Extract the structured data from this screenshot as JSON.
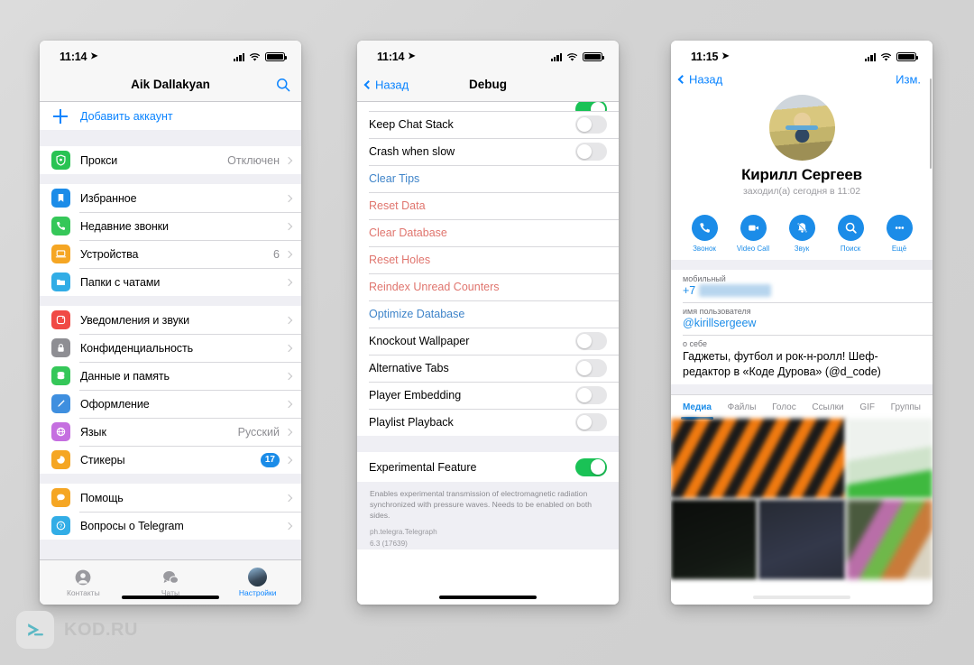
{
  "watermark": {
    "text": "KOD.RU",
    "logo_icon": "send-arrow-icon",
    "logo_color": "#5bb8c4"
  },
  "colors": {
    "ios_blue": "#0b84ff",
    "telegram_blue": "#1b8ce8",
    "destructive_red": "#e0756e",
    "toggle_on_green": "#1ac256",
    "group_bg": "#efeff4"
  },
  "phone1": {
    "status": {
      "time": "11:14",
      "location_icon": "location-arrow-icon",
      "signal_icon": "cellular-signal-icon",
      "wifi_icon": "wifi-icon",
      "battery_icon": "battery-full-icon"
    },
    "nav": {
      "title": "Aik Dallakyan",
      "search_icon": "search-icon"
    },
    "add_account": {
      "label": "Добавить аккаунт",
      "icon": "plus-icon"
    },
    "groups": [
      {
        "rows": [
          {
            "icon": "shield-proxy-icon",
            "color": "#29c353",
            "label": "Прокси",
            "value": "Отключен",
            "chevron": true
          }
        ]
      },
      {
        "rows": [
          {
            "icon": "bookmark-icon",
            "color": "#1b8ce8",
            "label": "Избранное",
            "value": "",
            "chevron": true
          },
          {
            "icon": "phone-icon",
            "color": "#35c759",
            "label": "Недавние звонки",
            "value": "",
            "chevron": true
          },
          {
            "icon": "laptop-icon",
            "color": "#f5a623",
            "label": "Устройства",
            "value": "6",
            "chevron": true
          },
          {
            "icon": "folder-icon",
            "color": "#32ade6",
            "label": "Папки с чатами",
            "value": "",
            "chevron": true
          }
        ]
      },
      {
        "rows": [
          {
            "icon": "bell-icon",
            "color": "#f04a45",
            "label": "Уведомления и звуки",
            "value": "",
            "chevron": true
          },
          {
            "icon": "lock-icon",
            "color": "#8e8e93",
            "label": "Конфиденциальность",
            "value": "",
            "chevron": true
          },
          {
            "icon": "database-icon",
            "color": "#35c759",
            "label": "Данные и память",
            "value": "",
            "chevron": true
          },
          {
            "icon": "brush-icon",
            "color": "#3f8fdf",
            "label": "Оформление",
            "value": "",
            "chevron": true
          },
          {
            "icon": "globe-icon",
            "color": "#c56fe0",
            "label": "Язык",
            "value": "Русский",
            "chevron": true
          },
          {
            "icon": "sticker-icon",
            "color": "#f5a623",
            "label": "Стикеры",
            "badge": "17",
            "chevron": true
          }
        ]
      },
      {
        "rows": [
          {
            "icon": "chat-help-icon",
            "color": "#f5a623",
            "label": "Помощь",
            "value": "",
            "chevron": true
          },
          {
            "icon": "question-icon",
            "color": "#32ade6",
            "label": "Вопросы о Telegram",
            "value": "",
            "chevron": true
          }
        ]
      }
    ],
    "tabbar": [
      {
        "icon": "contacts-person-icon",
        "label": "Контакты",
        "active": false
      },
      {
        "icon": "chats-bubbles-icon",
        "label": "Чаты",
        "active": false
      },
      {
        "icon": "settings-avatar-icon",
        "label": "Настройки",
        "active": true
      }
    ]
  },
  "phone2": {
    "status": {
      "time": "11:14",
      "location_icon": "location-arrow-icon",
      "signal_icon": "cellular-signal-icon",
      "wifi_icon": "wifi-icon",
      "battery_icon": "battery-full-icon"
    },
    "nav": {
      "back_label": "Назад",
      "title": "Debug",
      "back_icon": "chevron-left-icon"
    },
    "rows": [
      {
        "type": "toggle",
        "label": "",
        "on": true,
        "partial": true
      },
      {
        "type": "toggle",
        "label": "Keep Chat Stack",
        "on": false
      },
      {
        "type": "toggle",
        "label": "Crash when slow",
        "on": false
      },
      {
        "type": "action",
        "label": "Clear Tips",
        "style": "blue"
      },
      {
        "type": "action",
        "label": "Reset Data",
        "style": "red"
      },
      {
        "type": "action",
        "label": "Clear Database",
        "style": "red"
      },
      {
        "type": "action",
        "label": "Reset Holes",
        "style": "red"
      },
      {
        "type": "action",
        "label": "Reindex Unread Counters",
        "style": "red"
      },
      {
        "type": "action",
        "label": "Optimize Database",
        "style": "blue"
      },
      {
        "type": "toggle",
        "label": "Knockout Wallpaper",
        "on": false
      },
      {
        "type": "toggle",
        "label": "Alternative Tabs",
        "on": false
      },
      {
        "type": "toggle",
        "label": "Player Embedding",
        "on": false
      },
      {
        "type": "toggle",
        "label": "Playlist Playback",
        "on": false
      }
    ],
    "experimental": {
      "label": "Experimental Feature",
      "on": true
    },
    "footnote": "Enables experimental transmission of electromagnetic radiation synchronized with pressure waves. Needs to be enabled on both sides.",
    "version_bundle": "ph.telegra.Telegraph",
    "version_number": "6.3 (17639)"
  },
  "phone3": {
    "status": {
      "time": "11:15",
      "location_icon": "location-arrow-icon",
      "signal_icon": "cellular-signal-icon",
      "wifi_icon": "wifi-icon",
      "battery_icon": "battery-full-icon"
    },
    "nav": {
      "back_label": "Назад",
      "edit_label": "Изм.",
      "back_icon": "chevron-left-icon"
    },
    "profile": {
      "name": "Кирилл Сергеев",
      "status": "заходил(а) сегодня в 11:02",
      "avatar_icon": "user-photo-avatar"
    },
    "actions": [
      {
        "icon": "phone-call-icon",
        "label": "Звонок"
      },
      {
        "icon": "video-camera-icon",
        "label": "Video Call"
      },
      {
        "icon": "bell-muted-icon",
        "label": "Звук"
      },
      {
        "icon": "search-icon",
        "label": "Поиск"
      },
      {
        "icon": "ellipsis-icon",
        "label": "Ещё"
      }
    ],
    "info": [
      {
        "key": "мобильный",
        "value": "+7",
        "redacted": true
      },
      {
        "key": "имя пользователя",
        "value": "@kirillsergeew",
        "redacted": false
      },
      {
        "key": "о себе",
        "value": "Гаджеты, футбол и рок-н-ролл! Шеф-редактор в «Коде Дурова» (@d_code)",
        "redacted": false,
        "dark": true
      }
    ],
    "media_tabs": [
      {
        "label": "Медиа",
        "active": true
      },
      {
        "label": "Файлы",
        "active": false
      },
      {
        "label": "Голос",
        "active": false
      },
      {
        "label": "Ссылки",
        "active": false
      },
      {
        "label": "GIF",
        "active": false
      },
      {
        "label": "Группы",
        "active": false
      }
    ],
    "media_cells": [
      {
        "name": "media-thumb-1"
      },
      {
        "name": "media-thumb-2"
      },
      {
        "name": "media-thumb-3"
      },
      {
        "name": "media-thumb-4"
      },
      {
        "name": "media-thumb-5"
      },
      {
        "name": "media-thumb-6"
      }
    ]
  }
}
